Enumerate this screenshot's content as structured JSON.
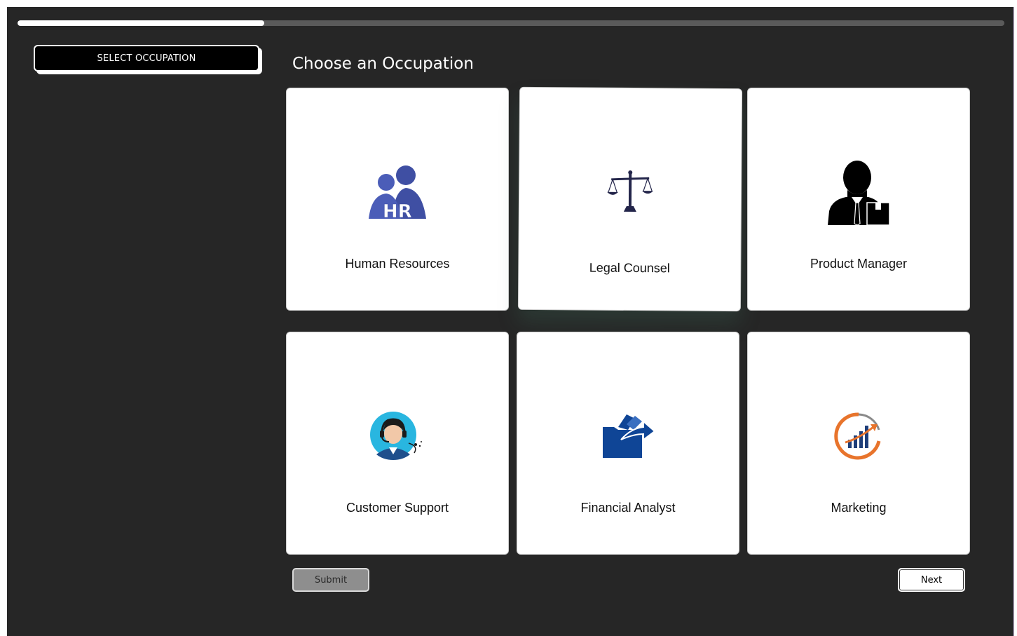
{
  "progress": {
    "fraction": 0.25
  },
  "sidebar": {
    "step_label": "SELECT OCCUPATION"
  },
  "main": {
    "heading": "Choose an Occupation",
    "cards": [
      {
        "label": "Human Resources",
        "icon": "hr-people-icon"
      },
      {
        "label": "Legal Counsel",
        "icon": "scales-of-justice-icon"
      },
      {
        "label": "Product Manager",
        "icon": "businessman-with-box-icon"
      },
      {
        "label": "Customer Support",
        "icon": "support-agent-headset-icon"
      },
      {
        "label": "Financial Analyst",
        "icon": "folder-arrow-icon"
      },
      {
        "label": "Marketing",
        "icon": "growth-chart-icon"
      }
    ]
  },
  "footer": {
    "submit_label": "Submit",
    "next_label": "Next"
  },
  "colors": {
    "background": "#262626",
    "hr_blue": "#3f4fa3",
    "finance_blue": "#0f4596",
    "marketing_orange": "#e8742c",
    "support_cyan": "#29b6e0"
  }
}
